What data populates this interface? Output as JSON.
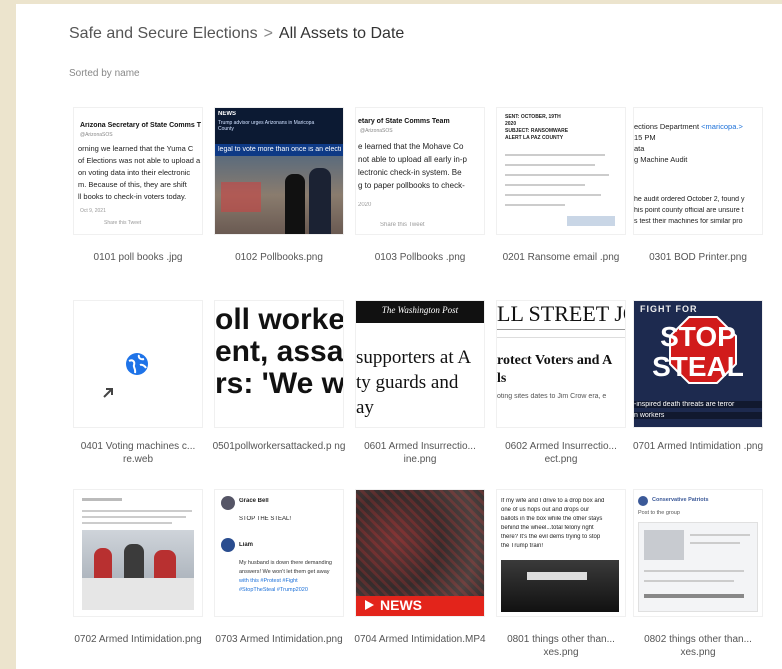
{
  "breadcrumb": {
    "parent": "Safe and Secure Elections",
    "separator": ">",
    "current": "All Assets to Date"
  },
  "sort_label": "Sorted by name",
  "assets": [
    {
      "name": "0101 poll books .jpg",
      "thumb": {
        "lines": [
          "Arizona Secretary of State Comms T",
          "@ArizonaSOS",
          "orning we learned that the Yuma C",
          "of Elections was not able to upload a",
          "on voting data into their electronic",
          "m. Because of this, they are shift",
          "ll books to check-in voters today.",
          "Oct 9, 2021",
          "Share this Tweet"
        ]
      }
    },
    {
      "name": "0102 Pollbooks.png",
      "thumb": {
        "banner": "NEWS",
        "headline": "Trump advisor urges Arizonans in Maricopa County",
        "ticker": "legal to vote more than once is an electi"
      }
    },
    {
      "name": "0103 Pollbooks .png",
      "thumb": {
        "lines": [
          "etary of State Comms Team",
          "@ArizonaSOS",
          "e learned that the Mohave Co",
          "not able to upload all early in-p",
          "lectronic check-in system. Be",
          "g to paper pollbooks to check-",
          "2020",
          "Share this Tweet"
        ]
      }
    },
    {
      "name": "0201 Ransome email .png",
      "thumb": {
        "lines": [
          "SENT: OCTOBER, 19TH",
          "2020",
          "SUBJECT: RANSOMWARE",
          "ALERT LA PAZ COUNTY"
        ]
      }
    },
    {
      "name": "0301 BOD Printer.png",
      "thumb": {
        "lines": [
          "ections Department",
          "<maricopa.>",
          "15 PM",
          "ata",
          "g Machine Audit",
          "he audit ordered October 2, found y",
          "his point county official are unsure t",
          "s test their machines for similar pro"
        ]
      }
    },
    {
      "name": "0401 Voting machines c... re.web",
      "thumb": {
        "globe": "globe-icon"
      }
    },
    {
      "name": "0501pollworkersattacked.p ng",
      "thumb": {
        "lines": [
          "oll worker",
          "ent, assau",
          "rs: 'We wo"
        ]
      }
    },
    {
      "name": "0601 Armed Insurrectio... ine.png",
      "thumb": {
        "masthead": "The Washington Post",
        "lines": [
          "supporters at A",
          "ty guards and",
          "ay"
        ]
      }
    },
    {
      "name": "0602 Armed Insurrectio... ect.png",
      "thumb": {
        "masthead": "LL STREET JOU",
        "lines": [
          "rotect Voters and A",
          "ls",
          "oting sites dates to Jim Crow era, e"
        ]
      }
    },
    {
      "name": "0701 Armed Intimidation .png",
      "thumb": {
        "top": "FIGHT FOR",
        "lines": [
          "STOP",
          "STEAL"
        ],
        "caption": "-inspired death threats are terror",
        "caption2": "n workers"
      }
    },
    {
      "name": "0702 Armed Intimidation.png",
      "thumb": {}
    },
    {
      "name": "0703 Armed Intimidation.png",
      "thumb": {
        "lines": [
          "Grace Bell",
          "STOP THE STEAL!",
          "Liam",
          "My husband is down there demanding",
          "answers! We won't let them get away",
          "with this #Protest #Fight",
          "#StopTheSteal #Trump2020"
        ]
      }
    },
    {
      "name": "0704 Armed Intimidation.MP4",
      "thumb": {
        "banner": "NEWS"
      }
    },
    {
      "name": "0801 things other than... xes.png",
      "thumb": {
        "lines": [
          "If my wife and I drive to a drop box and",
          "one of us hops out and drops our",
          "ballots in the box while the other stays",
          "behind the wheel...total felony right",
          "there? It's the evil dems trying to stop",
          "the Trump train!"
        ]
      }
    },
    {
      "name": "0802 things other than... xes.png",
      "thumb": {
        "lines": [
          "Conservative Patriots",
          "Post to the group"
        ]
      }
    }
  ],
  "colors": {
    "link": "#1a6fd8",
    "red": "#d11b1b",
    "news_red": "#e3241b",
    "globe": "#1e73e8"
  }
}
